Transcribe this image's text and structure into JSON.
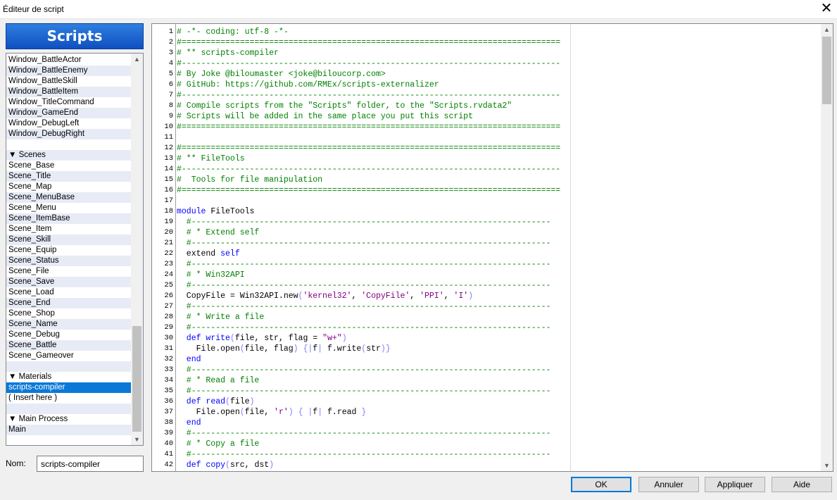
{
  "window": {
    "title": "Éditeur de script"
  },
  "sidebar": {
    "header": "Scripts",
    "items": [
      {
        "label": "Window_BattleActor",
        "type": "item"
      },
      {
        "label": "Window_BattleEnemy",
        "type": "item"
      },
      {
        "label": "Window_BattleSkill",
        "type": "item"
      },
      {
        "label": "Window_BattleItem",
        "type": "item"
      },
      {
        "label": "Window_TitleCommand",
        "type": "item"
      },
      {
        "label": "Window_GameEnd",
        "type": "item"
      },
      {
        "label": "Window_DebugLeft",
        "type": "item"
      },
      {
        "label": "Window_DebugRight",
        "type": "item"
      },
      {
        "label": "",
        "type": "empty"
      },
      {
        "label": "▼ Scenes",
        "type": "section"
      },
      {
        "label": "Scene_Base",
        "type": "item"
      },
      {
        "label": "Scene_Title",
        "type": "item"
      },
      {
        "label": "Scene_Map",
        "type": "item"
      },
      {
        "label": "Scene_MenuBase",
        "type": "item"
      },
      {
        "label": "Scene_Menu",
        "type": "item"
      },
      {
        "label": "Scene_ItemBase",
        "type": "item"
      },
      {
        "label": "Scene_Item",
        "type": "item"
      },
      {
        "label": "Scene_Skill",
        "type": "item"
      },
      {
        "label": "Scene_Equip",
        "type": "item"
      },
      {
        "label": "Scene_Status",
        "type": "item"
      },
      {
        "label": "Scene_File",
        "type": "item"
      },
      {
        "label": "Scene_Save",
        "type": "item"
      },
      {
        "label": "Scene_Load",
        "type": "item"
      },
      {
        "label": "Scene_End",
        "type": "item"
      },
      {
        "label": "Scene_Shop",
        "type": "item"
      },
      {
        "label": "Scene_Name",
        "type": "item"
      },
      {
        "label": "Scene_Debug",
        "type": "item"
      },
      {
        "label": "Scene_Battle",
        "type": "item"
      },
      {
        "label": "Scene_Gameover",
        "type": "item"
      },
      {
        "label": "",
        "type": "empty"
      },
      {
        "label": "▼ Materials",
        "type": "section"
      },
      {
        "label": "scripts-compiler",
        "type": "item",
        "selected": true
      },
      {
        "label": "( Insert here )",
        "type": "item"
      },
      {
        "label": "",
        "type": "empty"
      },
      {
        "label": "▼ Main Process",
        "type": "section"
      },
      {
        "label": "Main",
        "type": "item"
      }
    ]
  },
  "name_field": {
    "label": "Nom:",
    "value": "scripts-compiler"
  },
  "editor": {
    "lines": [
      [
        [
          "cm",
          "# -*- coding: utf-8 -*-"
        ]
      ],
      [
        [
          "cm",
          "#=============================================================================="
        ]
      ],
      [
        [
          "cm",
          "# ** scripts-compiler"
        ]
      ],
      [
        [
          "cm",
          "#------------------------------------------------------------------------------"
        ]
      ],
      [
        [
          "cm",
          "# By Joke @biloumaster <joke@biloucorp.com>"
        ]
      ],
      [
        [
          "cm",
          "# GitHub: https://github.com/RMEx/scripts-externalizer"
        ]
      ],
      [
        [
          "cm",
          "#------------------------------------------------------------------------------"
        ]
      ],
      [
        [
          "cm",
          "# Compile scripts from the \"Scripts\" folder, to the \"Scripts.rvdata2\""
        ]
      ],
      [
        [
          "cm",
          "# Scripts will be added in the same place you put this script"
        ]
      ],
      [
        [
          "cm",
          "#=============================================================================="
        ]
      ],
      [],
      [
        [
          "cm",
          "#=============================================================================="
        ]
      ],
      [
        [
          "cm",
          "# ** FileTools"
        ]
      ],
      [
        [
          "cm",
          "#------------------------------------------------------------------------------"
        ]
      ],
      [
        [
          "cm",
          "#  Tools for file manipulation"
        ]
      ],
      [
        [
          "cm",
          "#=============================================================================="
        ]
      ],
      [],
      [
        [
          "kw",
          "module"
        ],
        [
          "",
          " FileTools"
        ]
      ],
      [
        [
          "cm",
          "  #--------------------------------------------------------------------------"
        ]
      ],
      [
        [
          "cm",
          "  # * Extend self"
        ]
      ],
      [
        [
          "cm",
          "  #--------------------------------------------------------------------------"
        ]
      ],
      [
        [
          "",
          "  extend "
        ],
        [
          "kw",
          "self"
        ]
      ],
      [
        [
          "cm",
          "  #--------------------------------------------------------------------------"
        ]
      ],
      [
        [
          "cm",
          "  # * Win32API"
        ]
      ],
      [
        [
          "cm",
          "  #--------------------------------------------------------------------------"
        ]
      ],
      [
        [
          "",
          "  CopyFile = Win32API.new"
        ],
        [
          "br",
          "("
        ],
        [
          "str",
          "'kernel32'"
        ],
        [
          "",
          ", "
        ],
        [
          "str",
          "'CopyFile'"
        ],
        [
          "",
          ", "
        ],
        [
          "str",
          "'PPI'"
        ],
        [
          "",
          ", "
        ],
        [
          "str",
          "'I'"
        ],
        [
          "br",
          ")"
        ]
      ],
      [
        [
          "cm",
          "  #--------------------------------------------------------------------------"
        ]
      ],
      [
        [
          "cm",
          "  # * Write a file"
        ]
      ],
      [
        [
          "cm",
          "  #--------------------------------------------------------------------------"
        ]
      ],
      [
        [
          "kw",
          "  def"
        ],
        [
          "",
          " "
        ],
        [
          "kw",
          "write"
        ],
        [
          "br",
          "("
        ],
        [
          "",
          "file, str, flag = "
        ],
        [
          "str",
          "\"w+\""
        ],
        [
          "br",
          ")"
        ]
      ],
      [
        [
          "",
          "    File.open"
        ],
        [
          "br",
          "("
        ],
        [
          "",
          "file, flag"
        ],
        [
          "br",
          ")"
        ],
        [
          "",
          " "
        ],
        [
          "br",
          "{|"
        ],
        [
          "",
          "f"
        ],
        [
          "br",
          "|"
        ],
        [
          "",
          " f.write"
        ],
        [
          "br",
          "("
        ],
        [
          "",
          "str"
        ],
        [
          "br",
          ")}"
        ]
      ],
      [
        [
          "kw",
          "  end"
        ]
      ],
      [
        [
          "cm",
          "  #--------------------------------------------------------------------------"
        ]
      ],
      [
        [
          "cm",
          "  # * Read a file"
        ]
      ],
      [
        [
          "cm",
          "  #--------------------------------------------------------------------------"
        ]
      ],
      [
        [
          "kw",
          "  def"
        ],
        [
          "",
          " "
        ],
        [
          "kw",
          "read"
        ],
        [
          "br",
          "("
        ],
        [
          "",
          "file"
        ],
        [
          "br",
          ")"
        ]
      ],
      [
        [
          "",
          "    File.open"
        ],
        [
          "br",
          "("
        ],
        [
          "",
          "file, "
        ],
        [
          "str",
          "'r'"
        ],
        [
          "br",
          ")"
        ],
        [
          "",
          " "
        ],
        [
          "br",
          "{ |"
        ],
        [
          "",
          "f"
        ],
        [
          "br",
          "|"
        ],
        [
          "",
          " f.read "
        ],
        [
          "br",
          "}"
        ]
      ],
      [
        [
          "kw",
          "  end"
        ]
      ],
      [
        [
          "cm",
          "  #--------------------------------------------------------------------------"
        ]
      ],
      [
        [
          "cm",
          "  # * Copy a file"
        ]
      ],
      [
        [
          "cm",
          "  #--------------------------------------------------------------------------"
        ]
      ],
      [
        [
          "kw",
          "  def"
        ],
        [
          "",
          " "
        ],
        [
          "kw",
          "copy"
        ],
        [
          "br",
          "("
        ],
        [
          "",
          "src, dst"
        ],
        [
          "br",
          ")"
        ]
      ]
    ]
  },
  "buttons": {
    "ok": {
      "label": "OK",
      "underline": "O"
    },
    "cancel": {
      "label": "Annuler",
      "underline": "A"
    },
    "apply": {
      "label": "Appliquer",
      "underline": "A"
    },
    "help": {
      "label": "Aide"
    }
  },
  "icons": {
    "close": "close-icon",
    "up": "scroll-up-icon",
    "down": "scroll-down-icon"
  }
}
